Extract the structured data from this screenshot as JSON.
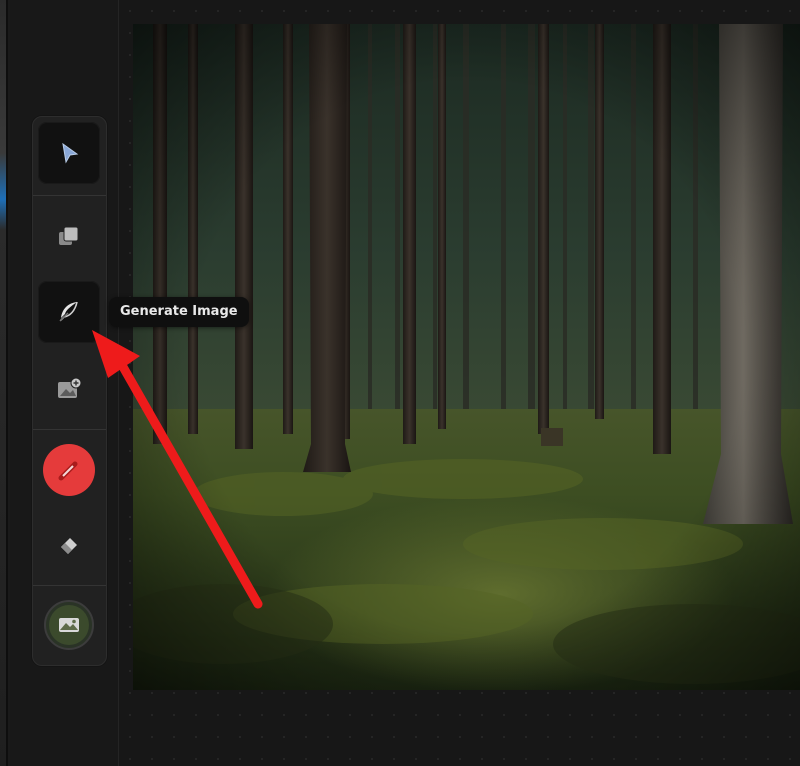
{
  "tooltip": {
    "text": "Generate Image"
  },
  "toolbar": {
    "tools": [
      {
        "name": "select",
        "icon": "cursor-arrow-icon",
        "active": true
      },
      {
        "name": "layers",
        "icon": "layers-icon",
        "active": false
      },
      {
        "name": "generate-image",
        "icon": "feather-icon",
        "active": true
      },
      {
        "name": "add-image",
        "icon": "image-plus-icon",
        "active": false
      },
      {
        "name": "brush",
        "icon": "brush-icon",
        "active": false,
        "color": "#e53b3b"
      },
      {
        "name": "eraser",
        "icon": "eraser-icon",
        "active": false
      },
      {
        "name": "background",
        "icon": "image-thumbnail-icon",
        "active": false
      }
    ]
  },
  "annotation": {
    "arrow_color": "#ee1b1b"
  },
  "canvas": {
    "image_subject": "forest-photo"
  }
}
